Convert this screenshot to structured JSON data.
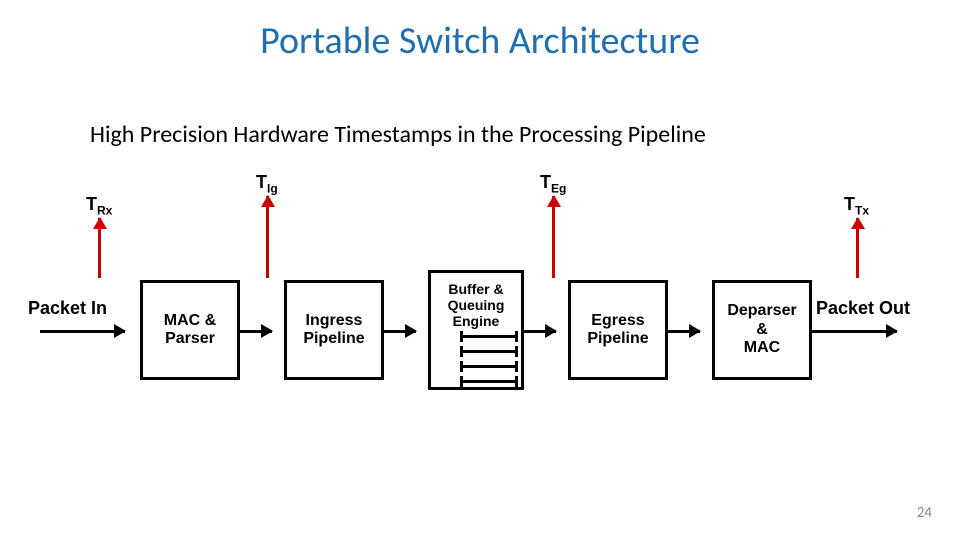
{
  "title": "Portable Switch Architecture",
  "subtitle": "High Precision Hardware Timestamps in the Processing Pipeline",
  "io": {
    "in": "Packet In",
    "out": "Packet Out"
  },
  "blocks": {
    "mac_parser": "MAC &\nParser",
    "ingress": "Ingress\nPipeline",
    "buffer": "Buffer &\nQueuing\nEngine",
    "egress": "Egress\nPipeline",
    "deparser": "Deparser\n&\nMAC"
  },
  "timestamps": {
    "rx": "Rx",
    "ig": "Ig",
    "eg": "Eg",
    "tx": "Tx"
  },
  "page_number": "24"
}
